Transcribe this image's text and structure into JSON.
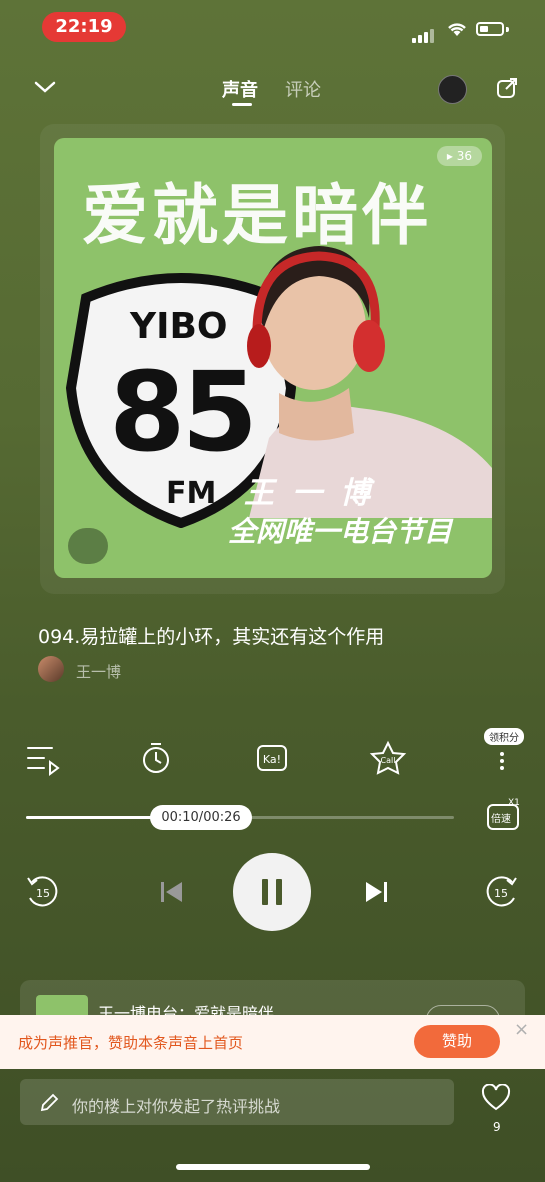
{
  "status_bar": {
    "time": "22:19"
  },
  "header": {
    "tabs": [
      {
        "label": "声音",
        "active": true
      },
      {
        "label": "评论",
        "active": false
      }
    ]
  },
  "cover": {
    "title": "爱就是暗伴",
    "logo_top": "YIBO",
    "logo_number": "85",
    "logo_bottom": "FM",
    "artist": "王一博",
    "subtitle": "全网唯一电台节目",
    "badge": "36"
  },
  "track": {
    "title": "094.易拉罐上的小环，其实还有这个作用",
    "artist": "王一博"
  },
  "toolbar": {
    "score_badge": "领积分"
  },
  "player": {
    "elapsed": "00:10",
    "duration": "00:26",
    "time_display": "00:10/00:26",
    "progress": 0.385,
    "speed_label": "倍速",
    "speed_value": "X1",
    "rewind": "15",
    "forward": "15"
  },
  "mini_card": {
    "text": "王一博电台：爱就是暗伴"
  },
  "banner": {
    "text": "成为声推官，赞助本条声音上首页",
    "button": "赞助",
    "close": "×"
  },
  "comment": {
    "placeholder": "你的楼上对你发起了热评挑战",
    "like_count": "9"
  },
  "colors": {
    "accent": "#f26a3b",
    "time_pill": "#e53935",
    "cover_bg": "#8ec26a"
  }
}
